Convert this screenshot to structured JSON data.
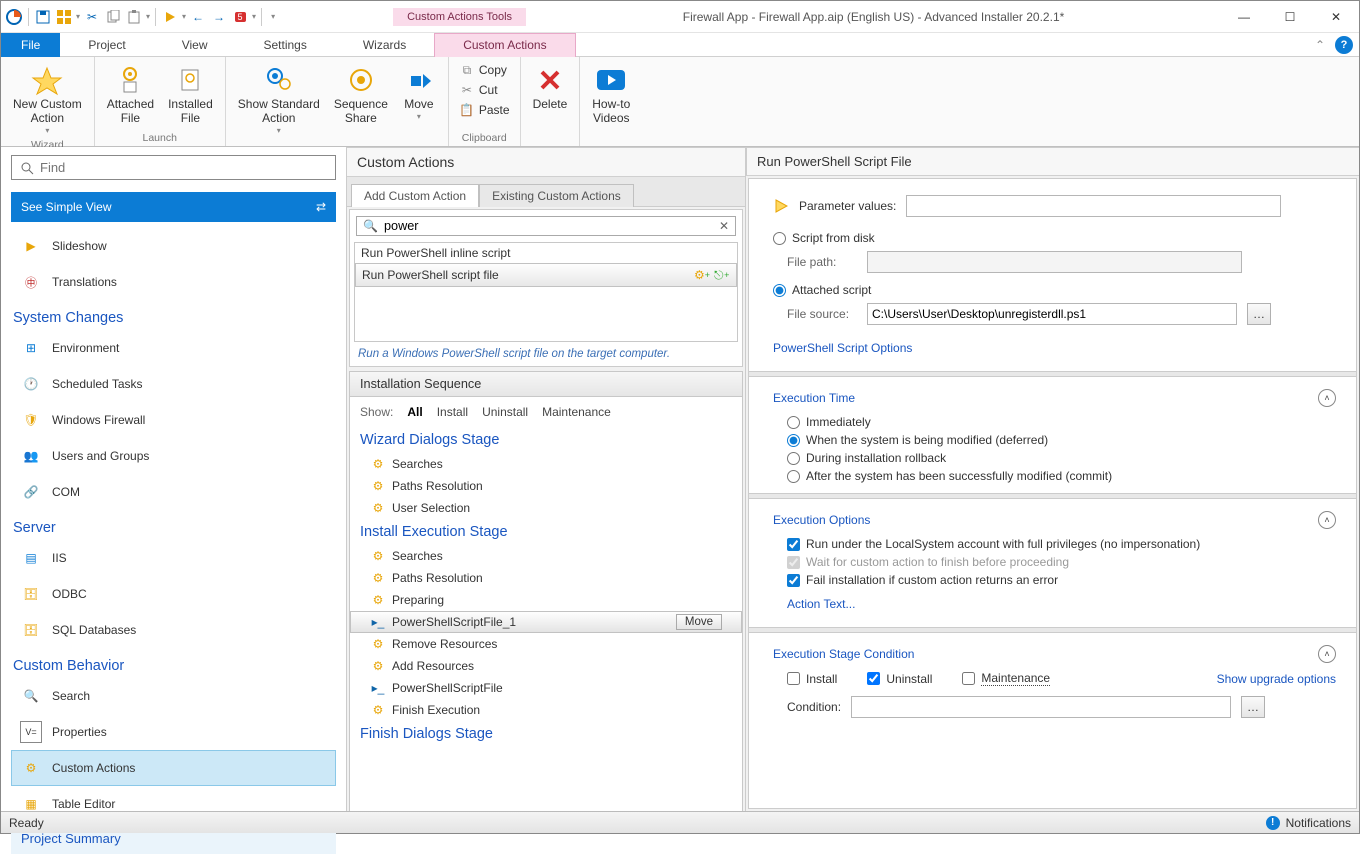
{
  "window": {
    "contextual_tab_title": "Custom Actions Tools",
    "title": "Firewall App - Firewall App.aip (English US) - Advanced Installer 20.2.1*"
  },
  "menu": {
    "file": "File",
    "tabs": [
      "Project",
      "View",
      "Settings",
      "Wizards",
      "Custom Actions"
    ]
  },
  "ribbon": {
    "groups": {
      "wizard_label": "Wizard",
      "launch_label": "Launch",
      "clipboard_label": "Clipboard"
    },
    "new_custom_action": "New Custom\nAction",
    "attached_file": "Attached\nFile",
    "installed_file": "Installed\nFile",
    "show_standard": "Show Standard\nAction",
    "sequence_share": "Sequence\nShare",
    "move": "Move",
    "copy": "Copy",
    "cut": "Cut",
    "paste": "Paste",
    "delete": "Delete",
    "howto": "How-to\nVideos"
  },
  "sidebar": {
    "find_placeholder": "Find",
    "simple_view": "See Simple View",
    "items": {
      "slideshow": "Slideshow",
      "translations": "Translations",
      "hdr_system": "System Changes",
      "environment": "Environment",
      "scheduled": "Scheduled Tasks",
      "firewall": "Windows Firewall",
      "users": "Users and Groups",
      "com": "COM",
      "hdr_server": "Server",
      "iis": "IIS",
      "odbc": "ODBC",
      "sql": "SQL Databases",
      "hdr_behavior": "Custom Behavior",
      "search": "Search",
      "properties": "Properties",
      "custom_actions": "Custom Actions",
      "table_editor": "Table Editor"
    },
    "project_summary": "Project Summary"
  },
  "mid": {
    "header": "Custom Actions",
    "tabs": {
      "add": "Add Custom Action",
      "existing": "Existing Custom Actions"
    },
    "search_value": "power",
    "results": {
      "r1": "Run PowerShell inline script",
      "r2": "Run PowerShell script file"
    },
    "hint": "Run a Windows PowerShell script file on the target computer.",
    "seq_header": "Installation Sequence",
    "show_label": "Show:",
    "show_opts": {
      "all": "All",
      "install": "Install",
      "uninstall": "Uninstall",
      "maint": "Maintenance"
    },
    "stages": {
      "wizard": "Wizard Dialogs Stage",
      "install": "Install Execution Stage",
      "finish": "Finish Dialogs Stage"
    },
    "wizard_items": {
      "searches": "Searches",
      "paths": "Paths Resolution",
      "user_sel": "User Selection"
    },
    "install_items": {
      "searches": "Searches",
      "paths": "Paths Resolution",
      "preparing": "Preparing",
      "ps1": "PowerShellScriptFile_1",
      "move": "Move",
      "remove": "Remove Resources",
      "add": "Add Resources",
      "ps": "PowerShellScriptFile",
      "finish": "Finish Execution"
    }
  },
  "right": {
    "header": "Run PowerShell Script File",
    "param_values": "Parameter values:",
    "script_disk": "Script from disk",
    "file_path": "File path:",
    "attached": "Attached script",
    "file_source": "File source:",
    "file_source_val": "C:\\Users\\User\\Desktop\\unregisterdll.ps1",
    "ps_options": "PowerShell Script Options",
    "exec_time": "Execution Time",
    "et_imm": "Immediately",
    "et_deferred": "When the system is being modified (deferred)",
    "et_rollback": "During installation rollback",
    "et_commit": "After the system has been successfully modified (commit)",
    "exec_opts": "Execution Options",
    "eo_local": "Run under the LocalSystem account with full privileges (no impersonation)",
    "eo_wait": "Wait for custom action to finish before proceeding",
    "eo_fail": "Fail installation if custom action returns an error",
    "action_text": "Action Text...",
    "stage_cond": "Execution Stage Condition",
    "sc_install": "Install",
    "sc_uninstall": "Uninstall",
    "sc_maint": "Maintenance",
    "sc_upgrade": "Show upgrade options",
    "condition": "Condition:"
  },
  "status": {
    "ready": "Ready",
    "notifications": "Notifications"
  }
}
